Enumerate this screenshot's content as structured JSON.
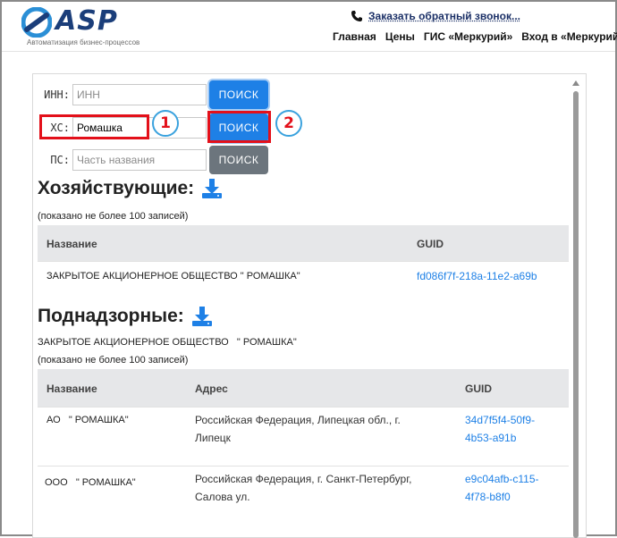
{
  "header": {
    "logo_text": "ASP",
    "logo_tagline": "Автоматизация бизнес-процессов",
    "callback_label": "Заказать обратный звонок...",
    "nav": [
      "Главная",
      "Цены",
      "ГИС «Меркурий»",
      "Вход в «Меркурий»"
    ]
  },
  "search": {
    "inn": {
      "label": "ИНН:",
      "placeholder": "ИНН",
      "value": "",
      "button": "ПОИСК"
    },
    "hs": {
      "label": "ХС:",
      "placeholder": "",
      "value": "Ромашка",
      "button": "ПОИСК"
    },
    "ps": {
      "label": "ПС:",
      "placeholder": "Часть названия",
      "value": "",
      "button": "ПОИСК"
    }
  },
  "annotations": [
    "1",
    "2"
  ],
  "entities": {
    "title": "Хозяйствующие:",
    "note": "(показано не более 100 записей)",
    "columns": [
      "Название",
      "GUID"
    ],
    "rows": [
      {
        "name": "ЗАКРЫТОЕ АКЦИОНЕРНОЕ ОБЩЕСТВО \" РОМАШКА\"",
        "guid": "fd086f7f-218a-11e2-a69b"
      }
    ]
  },
  "supervised": {
    "title": "Поднадзорные:",
    "owner": "ЗАКРЫТОЕ АКЦИОНЕРНОЕ ОБЩЕСТВО   \" РОМАШКА\"",
    "note": "(показано не более 100 записей)",
    "columns": [
      "Название",
      "Адрес",
      "GUID"
    ],
    "rows": [
      {
        "name": "АО   \" РОМАШКА\"",
        "address_1": "Российская Федерация, Липецкая обл., г.",
        "address_2": "Липецк",
        "guid_1": "34d7f5f4-50f9-",
        "guid_2": "4b53-a91b"
      },
      {
        "name": "ООО   \" РОМАШКА\"",
        "address_1": "Российская Федерация, г. Санкт-Петербург,",
        "address_2": "Салова ул.",
        "guid_1": "e9c04afb-c115-",
        "guid_2": "4f78-b8f0"
      }
    ]
  },
  "colors": {
    "primary": "#1e80e6",
    "secondary": "#6c757d",
    "annotation": "#e3101a",
    "annotation_ring": "#3aa2de"
  }
}
